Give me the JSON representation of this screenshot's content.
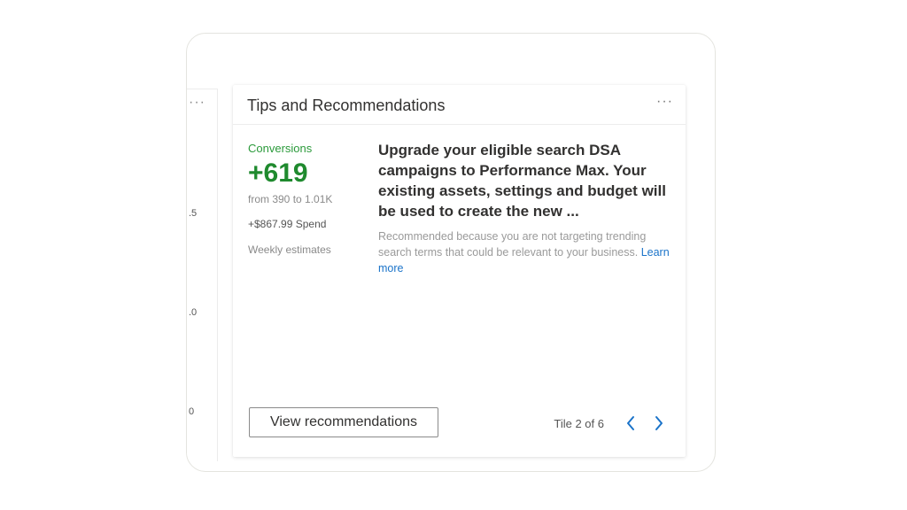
{
  "card": {
    "title": "Tips and Recommendations",
    "more_label": "···"
  },
  "left_panel": {
    "more_label": "···",
    "axis_labels": [
      ".5",
      ".0",
      "0"
    ]
  },
  "metric": {
    "label": "Conversions",
    "value": "+619",
    "range": "from 390 to 1.01K",
    "spend": "+$867.99 Spend",
    "note": "Weekly estimates"
  },
  "recommendation": {
    "headline": "Upgrade your eligible search DSA campaigns to Performance Max. Your existing assets, settings and budget will be used to create the new ...",
    "reason": "Recommended because you are not targeting trending search terms that could be relevant to your business.",
    "learn_more": "Learn more"
  },
  "actions": {
    "view_label": "View recommendations"
  },
  "pager": {
    "text": "Tile 2 of 6",
    "prev_icon": "chevron-left-icon",
    "next_icon": "chevron-right-icon"
  },
  "colors": {
    "accent_green": "#1f8a2e",
    "link_blue": "#1a73c9"
  }
}
